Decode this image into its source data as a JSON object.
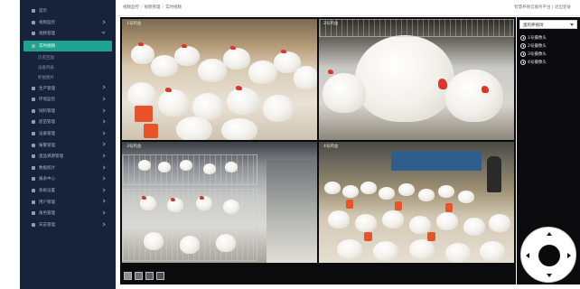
{
  "sidebar": {
    "items": [
      {
        "label": "首页",
        "icon": "home-icon"
      },
      {
        "label": "视频监控",
        "icon": "camera-icon"
      },
      {
        "label": "视频管理",
        "icon": "video-icon"
      },
      {
        "label": "实时视频",
        "icon": "monitor-icon",
        "active": true
      },
      {
        "label": "历史回放",
        "sub": true
      },
      {
        "label": "设备列表",
        "sub": true
      },
      {
        "label": "抓拍图片",
        "sub": true
      },
      {
        "label": "生产管理",
        "icon": "production-icon"
      },
      {
        "label": "环境监控",
        "icon": "environment-icon"
      },
      {
        "label": "饲料管理",
        "icon": "feed-icon"
      },
      {
        "label": "疫苗管理",
        "icon": "vaccine-icon"
      },
      {
        "label": "设备管理",
        "icon": "device-icon"
      },
      {
        "label": "报警管理",
        "icon": "alarm-icon"
      },
      {
        "label": "蛋品溯源管理",
        "icon": "trace-icon"
      },
      {
        "label": "数据统计",
        "icon": "stats-icon"
      },
      {
        "label": "报表中心",
        "icon": "report-icon"
      },
      {
        "label": "系统设置",
        "icon": "settings-icon"
      },
      {
        "label": "用户管理",
        "icon": "user-icon"
      },
      {
        "label": "角色管理",
        "icon": "role-icon"
      },
      {
        "label": "日志管理",
        "icon": "log-icon"
      }
    ]
  },
  "topbar": {
    "breadcrumb": [
      "视频监控",
      "视频管理",
      "实时视频"
    ],
    "right_text": "智慧养殖云服务平台 | 退出登录"
  },
  "video": {
    "tiles": [
      {
        "label": "1号鸡舍"
      },
      {
        "label": "2号鸡舍"
      },
      {
        "label": "3号鸡舍"
      },
      {
        "label": "4号鸡舍"
      }
    ]
  },
  "right_panel": {
    "select_value": "蛋鸡养殖场",
    "cameras": [
      "1号摄像头",
      "2号摄像头",
      "3号摄像头",
      "4号摄像头"
    ]
  },
  "layout_buttons": [
    "1画面",
    "4画面",
    "9画面",
    "16画面"
  ]
}
